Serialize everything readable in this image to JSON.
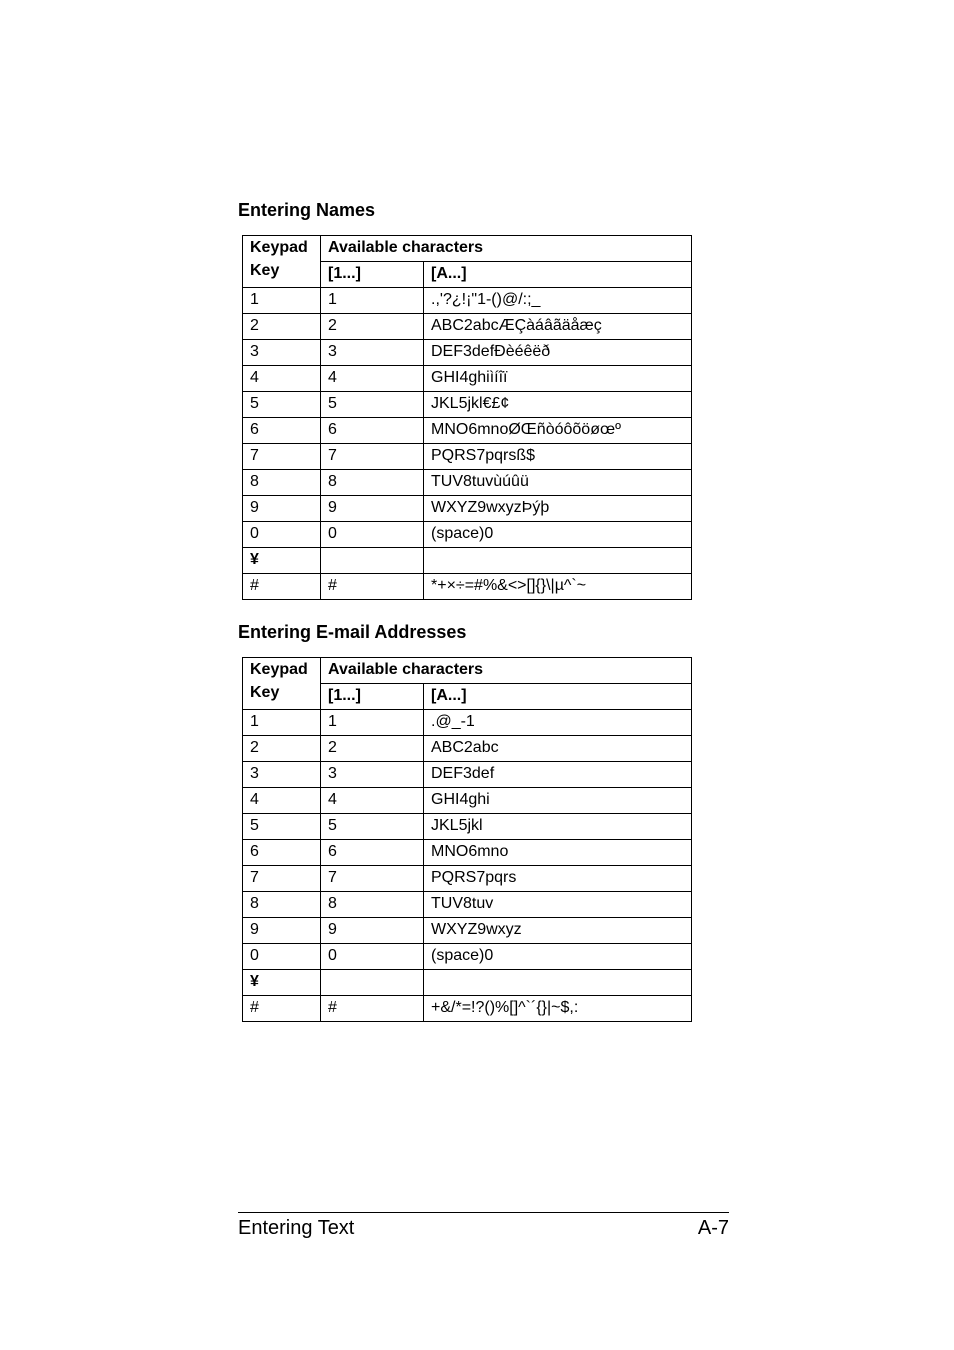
{
  "sections": {
    "names": {
      "heading": "Entering Names",
      "header": {
        "keypad": "Keypad",
        "available": "Available characters",
        "key": "Key",
        "num": "[1...]",
        "alpha": "[A...]"
      },
      "rows": [
        {
          "key": "1",
          "num": "1",
          "alpha": ".,'?¿!¡\"1-()@/:;_"
        },
        {
          "key": "2",
          "num": "2",
          "alpha": "ABC2abcÆÇàáâãäåæç"
        },
        {
          "key": "3",
          "num": "3",
          "alpha": "DEF3defÐèéêëð"
        },
        {
          "key": "4",
          "num": "4",
          "alpha": "GHI4ghiìíîï"
        },
        {
          "key": "5",
          "num": "5",
          "alpha": "JKL5jkl€£¢"
        },
        {
          "key": "6",
          "num": "6",
          "alpha": "MNO6mnoØŒñòóôõöøœº"
        },
        {
          "key": "7",
          "num": "7",
          "alpha": "PQRS7pqrsß$"
        },
        {
          "key": "8",
          "num": "8",
          "alpha": "TUV8tuvùúûü"
        },
        {
          "key": "9",
          "num": "9",
          "alpha": "WXYZ9wxyzÞýþ"
        },
        {
          "key": "0",
          "num": "0",
          "alpha": "(space)0"
        },
        {
          "key": "¥",
          "num": "",
          "alpha": ""
        },
        {
          "key": "#",
          "num": "#",
          "alpha": "*+×÷=#%&<>[]{}\\|µ^`~"
        }
      ]
    },
    "email": {
      "heading": "Entering E-mail Addresses",
      "header": {
        "keypad": "Keypad",
        "available": "Available characters",
        "key": "Key",
        "num": "[1...]",
        "alpha": "[A...]"
      },
      "rows": [
        {
          "key": "1",
          "num": "1",
          "alpha": ".@_-1"
        },
        {
          "key": "2",
          "num": "2",
          "alpha": "ABC2abc"
        },
        {
          "key": "3",
          "num": "3",
          "alpha": "DEF3def"
        },
        {
          "key": "4",
          "num": "4",
          "alpha": "GHI4ghi"
        },
        {
          "key": "5",
          "num": "5",
          "alpha": "JKL5jkl"
        },
        {
          "key": "6",
          "num": "6",
          "alpha": "MNO6mno"
        },
        {
          "key": "7",
          "num": "7",
          "alpha": "PQRS7pqrs"
        },
        {
          "key": "8",
          "num": "8",
          "alpha": "TUV8tuv"
        },
        {
          "key": "9",
          "num": "9",
          "alpha": "WXYZ9wxyz"
        },
        {
          "key": "0",
          "num": "0",
          "alpha": "(space)0"
        },
        {
          "key": "¥",
          "num": "",
          "alpha": ""
        },
        {
          "key": "#",
          "num": "#",
          "alpha": "+&/*=!?()%[]^`´{}|~$,:"
        }
      ]
    }
  },
  "footer": {
    "left": "Entering Text",
    "right": "A-7"
  }
}
